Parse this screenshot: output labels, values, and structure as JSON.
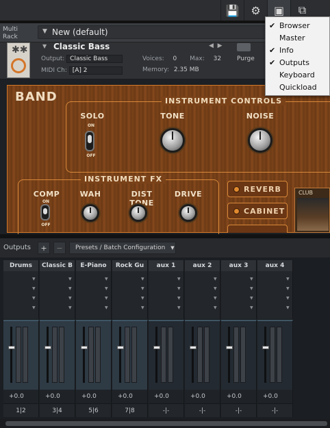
{
  "toolbar": {
    "buttons": [
      {
        "name": "save-icon",
        "glyph": "💾"
      },
      {
        "name": "gear-icon",
        "glyph": "⚙"
      },
      {
        "name": "view-layout-icon",
        "glyph": "▣"
      },
      {
        "name": "window-resize-icon",
        "glyph": "⧉"
      }
    ]
  },
  "rack": {
    "label_line1": "Multi",
    "label_line2": "Rack",
    "name": "New (default)"
  },
  "instrument": {
    "name": "Classic Bass",
    "output_label": "Output:",
    "output_value": "Classic Bass",
    "midi_label": "MIDI Ch:",
    "midi_value": "[A]  2",
    "voices_label": "Voices:",
    "voices_value": "0",
    "max_label": "Max:",
    "max_value": "32",
    "memory_label": "Memory:",
    "memory_value": "2.35 MB",
    "purge_label": "Purge"
  },
  "band": {
    "title": "BAND",
    "controls_title": "INSTRUMENT CONTROLS",
    "solo": "SOLO",
    "tone": "TONE",
    "noise": "NOISE",
    "on": "ON",
    "off": "OFF",
    "fx_title": "INSTRUMENT FX",
    "comp": "COMP",
    "wah": "WAH",
    "dist_tone": "DIST TONE",
    "drive": "DRIVE",
    "reverb": "REVERB",
    "cabinet": "CABINET",
    "club": "CLUB"
  },
  "outputs": {
    "label": "Outputs",
    "add": "+",
    "remove": "−",
    "presets": "Presets / Batch Configuration",
    "channels": [
      {
        "name": "Drums",
        "volume": "+0.0",
        "route": "1|2"
      },
      {
        "name": "Classic B",
        "volume": "+0.0",
        "route": "3|4"
      },
      {
        "name": "E-Piano",
        "volume": "+0.0",
        "route": "5|6"
      },
      {
        "name": "Rock Gu",
        "volume": "+0.0",
        "route": "7|8"
      },
      {
        "name": "aux 1",
        "volume": "+0.0",
        "route": "-|-"
      },
      {
        "name": "aux 2",
        "volume": "+0.0",
        "route": "-|-"
      },
      {
        "name": "aux 3",
        "volume": "+0.0",
        "route": "-|-"
      },
      {
        "name": "aux 4",
        "volume": "+0.0",
        "route": "-|-"
      }
    ]
  },
  "view_menu": {
    "items": [
      {
        "label": "Browser",
        "checked": "✔"
      },
      {
        "label": "Master",
        "checked": ""
      },
      {
        "label": "Info",
        "checked": "✔"
      },
      {
        "label": "Outputs",
        "checked": "✔"
      },
      {
        "label": "Keyboard",
        "checked": ""
      },
      {
        "label": "Quickload",
        "checked": ""
      }
    ]
  }
}
